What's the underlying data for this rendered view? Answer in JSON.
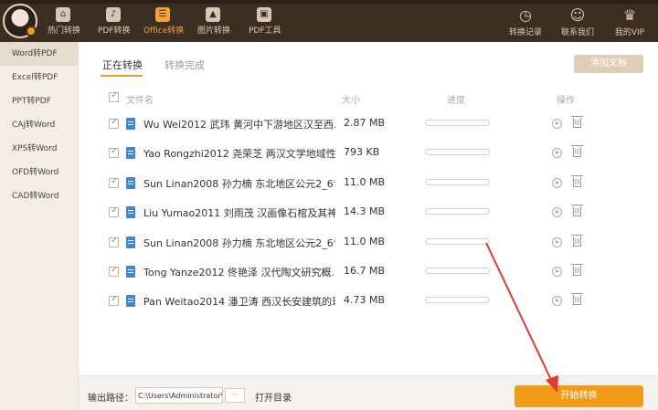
{
  "topbar": {
    "nav": [
      {
        "label": "热门转换",
        "icon": "hot-icon"
      },
      {
        "label": "PDF转换",
        "icon": "pdf-icon"
      },
      {
        "label": "Office转换",
        "icon": "office-icon",
        "active": true
      },
      {
        "label": "图片转换",
        "icon": "image-icon"
      },
      {
        "label": "PDF工具",
        "icon": "toolbox-icon"
      }
    ],
    "right": [
      {
        "label": "转换记录",
        "icon": "clock-icon"
      },
      {
        "label": "联系我们",
        "icon": "support-icon"
      },
      {
        "label": "我的VIP",
        "icon": "crown-icon"
      }
    ]
  },
  "sidebar": {
    "items": [
      {
        "label": "Word转PDF",
        "active": true
      },
      {
        "label": "Excel转PDF"
      },
      {
        "label": "PPT转PDF"
      },
      {
        "label": "CAJ转Word"
      },
      {
        "label": "XPS转Word"
      },
      {
        "label": "OFD转Word"
      },
      {
        "label": "CAD转Word"
      }
    ]
  },
  "tabs": {
    "converting": "正在转换",
    "done": "转换完成"
  },
  "add_doc": "添加文档",
  "table": {
    "headers": {
      "name": "文件名",
      "size": "大小",
      "progress": "进度",
      "actions": "操作"
    },
    "rows": [
      {
        "name": "Wu Wei2012 武玮 黄河中下游地区汉至西...",
        "size": "2.87 MB",
        "progress": 0
      },
      {
        "name": "Yao Rongzhi2012 尧荣芝 两汉文学地域性...",
        "size": "793 KB",
        "progress": 0
      },
      {
        "name": "Sun Linan2008 孙力楠 东北地区公元2_6世...",
        "size": "11.0 MB",
        "progress": 0
      },
      {
        "name": "Liu Yumao2011 刘雨茂 汉画像石棺及其神...",
        "size": "14.3 MB",
        "progress": 0
      },
      {
        "name": "Sun Linan2008 孙力楠 东北地区公元2_6世...",
        "size": "11.0 MB",
        "progress": 0
      },
      {
        "name": "Tong Yanze2012 佟艳泽 汉代陶文研究概...",
        "size": "16.7 MB",
        "progress": 0
      },
      {
        "name": "Pan Weitao2014 潘卫涛 西汉长安建筑的现...",
        "size": "4.73 MB",
        "progress": 0
      }
    ]
  },
  "bottom": {
    "output_label": "输出路径：",
    "path_value": "C:\\Users\\Administrator\\",
    "dots": "···",
    "open_dir": "打开目录",
    "start": "开始转换"
  },
  "colors": {
    "accent": "#f39a1a",
    "topbar": "#3b2f24",
    "annotation": "#e53935"
  }
}
